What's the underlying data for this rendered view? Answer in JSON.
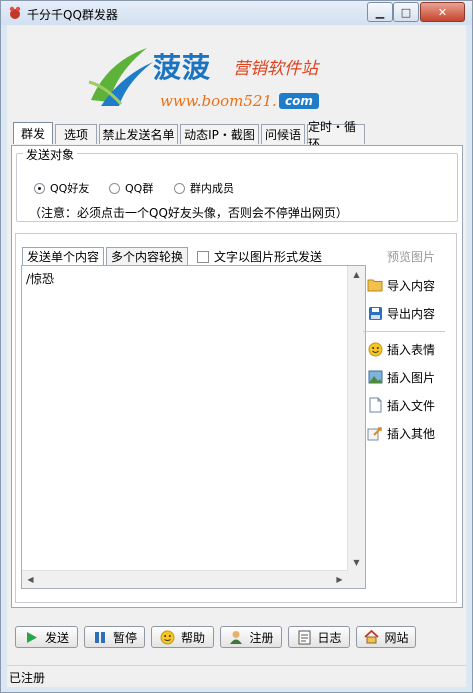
{
  "window": {
    "title": "千分千QQ群发器",
    "minimize": "▁",
    "maximize": "□",
    "close": "✕"
  },
  "banner": {
    "logo_text": "菠菠",
    "slogan": "营销软件站",
    "url": "www.boom521.",
    "url_com": "com"
  },
  "tabs": [
    {
      "label": "群发",
      "active": true
    },
    {
      "label": "选项"
    },
    {
      "label": "禁止发送名单"
    },
    {
      "label": "动态IP・截图"
    },
    {
      "label": "问候语"
    },
    {
      "label": "定时・循环"
    }
  ],
  "send_target": {
    "title": "发送对象",
    "options": [
      {
        "label": "QQ好友",
        "checked": true
      },
      {
        "label": "QQ群",
        "checked": false
      },
      {
        "label": "群内成员",
        "checked": false
      }
    ],
    "note": "（注意：必须点击一个QQ好友头像，否则会不停弹出网页）"
  },
  "content": {
    "subtabs": [
      {
        "label": "发送单个内容",
        "active": true
      },
      {
        "label": "多个内容轮换"
      }
    ],
    "image_send_checkbox": {
      "label": "文字以图片形式发送",
      "checked": false
    },
    "editor_value": "/惊恐",
    "preview_label": "预览图片",
    "side_buttons": [
      {
        "label": "导入内容",
        "icon": "folder-icon"
      },
      {
        "label": "导出内容",
        "icon": "save-icon"
      },
      {
        "label": "插入表情",
        "icon": "smiley-icon"
      },
      {
        "label": "插入图片",
        "icon": "picture-icon"
      },
      {
        "label": "插入文件",
        "icon": "file-icon"
      },
      {
        "label": "插入其他",
        "icon": "insert-other-icon"
      }
    ]
  },
  "bottom_buttons": [
    {
      "label": "发送",
      "icon": "play-icon"
    },
    {
      "label": "暂停",
      "icon": "pause-icon"
    },
    {
      "label": "帮助",
      "icon": "help-icon"
    },
    {
      "label": "注册",
      "icon": "user-icon"
    },
    {
      "label": "日志",
      "icon": "log-icon"
    },
    {
      "label": "网站",
      "icon": "home-icon"
    }
  ],
  "status": {
    "text": "已注册"
  },
  "colors": {
    "titlebar": "#dce7f4",
    "brand_blue": "#1a74c2",
    "brand_orange": "#e87219",
    "slogan_red": "#e0421f"
  }
}
